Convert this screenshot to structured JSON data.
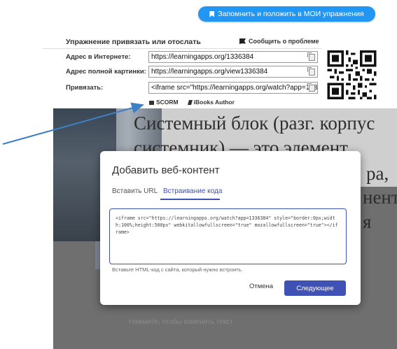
{
  "header": {
    "save_label": "Запомнить и положить в МОИ упражнения"
  },
  "embed": {
    "heading": "Упражнение привязать или отослать",
    "report_label": "Сообщить о проблеме",
    "rows": [
      {
        "label": "Адрес в Интернете:",
        "value": "https://learningapps.org/1336384"
      },
      {
        "label": "Адрес полной картинки:",
        "value": "https://learningapps.org/view1336384"
      },
      {
        "label": "Привязать:",
        "value": "<iframe src=\"https://learningapps.org/watch?app=1336384\""
      }
    ],
    "exports": [
      "SCORM",
      "iBooks Author"
    ]
  },
  "background": {
    "lines": [
      "Системный блок (разг. корпус",
      "системник) — это элемент",
      "ра,",
      "нент",
      "я"
    ],
    "hint": "Нажмите, чтобы изменить текст"
  },
  "dialog": {
    "title": "Добавить веб-контент",
    "tabs": [
      "Вставить URL",
      "Встраивание кода"
    ],
    "active_tab": "Встраивание кода",
    "code": "<iframe src=\"https://learningapps.org/watch?app=1336384\" style=\"border:0px;width:100%;height:500px\" webkitallowfullscreen=\"true\" mozallowfullscreen=\"true\"></iframe>",
    "helper": "Вставьте HTML-код с сайта, который нужно встроить.",
    "cancel_label": "Отмена",
    "next_label": "Следующее"
  },
  "colors": {
    "primary_blue": "#2196f3",
    "dialog_accent": "#3f51b5",
    "arrow": "#3d7fc4"
  }
}
